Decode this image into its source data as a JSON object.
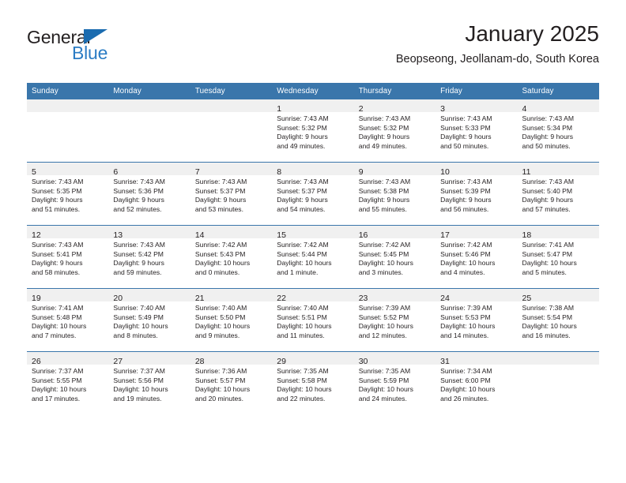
{
  "brand": {
    "name_part1": "General",
    "name_part2": "Blue",
    "triangle_color": "#1b6cb0",
    "blue_color": "#2b7cc4"
  },
  "header": {
    "title": "January 2025",
    "subtitle": "Beopseong, Jeollanam-do, South Korea"
  },
  "theme": {
    "header_bg": "#3a76ab",
    "daynum_bg": "#f0f0f0",
    "text": "#231f20"
  },
  "weekday_headers": [
    "Sunday",
    "Monday",
    "Tuesday",
    "Wednesday",
    "Thursday",
    "Friday",
    "Saturday"
  ],
  "weeks": [
    [
      {
        "day": "",
        "empty": true
      },
      {
        "day": "",
        "empty": true
      },
      {
        "day": "",
        "empty": true
      },
      {
        "day": "1",
        "sunrise": "Sunrise: 7:43 AM",
        "sunset": "Sunset: 5:32 PM",
        "daylight1": "Daylight: 9 hours",
        "daylight2": "and 49 minutes."
      },
      {
        "day": "2",
        "sunrise": "Sunrise: 7:43 AM",
        "sunset": "Sunset: 5:32 PM",
        "daylight1": "Daylight: 9 hours",
        "daylight2": "and 49 minutes."
      },
      {
        "day": "3",
        "sunrise": "Sunrise: 7:43 AM",
        "sunset": "Sunset: 5:33 PM",
        "daylight1": "Daylight: 9 hours",
        "daylight2": "and 50 minutes."
      },
      {
        "day": "4",
        "sunrise": "Sunrise: 7:43 AM",
        "sunset": "Sunset: 5:34 PM",
        "daylight1": "Daylight: 9 hours",
        "daylight2": "and 50 minutes."
      }
    ],
    [
      {
        "day": "5",
        "sunrise": "Sunrise: 7:43 AM",
        "sunset": "Sunset: 5:35 PM",
        "daylight1": "Daylight: 9 hours",
        "daylight2": "and 51 minutes."
      },
      {
        "day": "6",
        "sunrise": "Sunrise: 7:43 AM",
        "sunset": "Sunset: 5:36 PM",
        "daylight1": "Daylight: 9 hours",
        "daylight2": "and 52 minutes."
      },
      {
        "day": "7",
        "sunrise": "Sunrise: 7:43 AM",
        "sunset": "Sunset: 5:37 PM",
        "daylight1": "Daylight: 9 hours",
        "daylight2": "and 53 minutes."
      },
      {
        "day": "8",
        "sunrise": "Sunrise: 7:43 AM",
        "sunset": "Sunset: 5:37 PM",
        "daylight1": "Daylight: 9 hours",
        "daylight2": "and 54 minutes."
      },
      {
        "day": "9",
        "sunrise": "Sunrise: 7:43 AM",
        "sunset": "Sunset: 5:38 PM",
        "daylight1": "Daylight: 9 hours",
        "daylight2": "and 55 minutes."
      },
      {
        "day": "10",
        "sunrise": "Sunrise: 7:43 AM",
        "sunset": "Sunset: 5:39 PM",
        "daylight1": "Daylight: 9 hours",
        "daylight2": "and 56 minutes."
      },
      {
        "day": "11",
        "sunrise": "Sunrise: 7:43 AM",
        "sunset": "Sunset: 5:40 PM",
        "daylight1": "Daylight: 9 hours",
        "daylight2": "and 57 minutes."
      }
    ],
    [
      {
        "day": "12",
        "sunrise": "Sunrise: 7:43 AM",
        "sunset": "Sunset: 5:41 PM",
        "daylight1": "Daylight: 9 hours",
        "daylight2": "and 58 minutes."
      },
      {
        "day": "13",
        "sunrise": "Sunrise: 7:43 AM",
        "sunset": "Sunset: 5:42 PM",
        "daylight1": "Daylight: 9 hours",
        "daylight2": "and 59 minutes."
      },
      {
        "day": "14",
        "sunrise": "Sunrise: 7:42 AM",
        "sunset": "Sunset: 5:43 PM",
        "daylight1": "Daylight: 10 hours",
        "daylight2": "and 0 minutes."
      },
      {
        "day": "15",
        "sunrise": "Sunrise: 7:42 AM",
        "sunset": "Sunset: 5:44 PM",
        "daylight1": "Daylight: 10 hours",
        "daylight2": "and 1 minute."
      },
      {
        "day": "16",
        "sunrise": "Sunrise: 7:42 AM",
        "sunset": "Sunset: 5:45 PM",
        "daylight1": "Daylight: 10 hours",
        "daylight2": "and 3 minutes."
      },
      {
        "day": "17",
        "sunrise": "Sunrise: 7:42 AM",
        "sunset": "Sunset: 5:46 PM",
        "daylight1": "Daylight: 10 hours",
        "daylight2": "and 4 minutes."
      },
      {
        "day": "18",
        "sunrise": "Sunrise: 7:41 AM",
        "sunset": "Sunset: 5:47 PM",
        "daylight1": "Daylight: 10 hours",
        "daylight2": "and 5 minutes."
      }
    ],
    [
      {
        "day": "19",
        "sunrise": "Sunrise: 7:41 AM",
        "sunset": "Sunset: 5:48 PM",
        "daylight1": "Daylight: 10 hours",
        "daylight2": "and 7 minutes."
      },
      {
        "day": "20",
        "sunrise": "Sunrise: 7:40 AM",
        "sunset": "Sunset: 5:49 PM",
        "daylight1": "Daylight: 10 hours",
        "daylight2": "and 8 minutes."
      },
      {
        "day": "21",
        "sunrise": "Sunrise: 7:40 AM",
        "sunset": "Sunset: 5:50 PM",
        "daylight1": "Daylight: 10 hours",
        "daylight2": "and 9 minutes."
      },
      {
        "day": "22",
        "sunrise": "Sunrise: 7:40 AM",
        "sunset": "Sunset: 5:51 PM",
        "daylight1": "Daylight: 10 hours",
        "daylight2": "and 11 minutes."
      },
      {
        "day": "23",
        "sunrise": "Sunrise: 7:39 AM",
        "sunset": "Sunset: 5:52 PM",
        "daylight1": "Daylight: 10 hours",
        "daylight2": "and 12 minutes."
      },
      {
        "day": "24",
        "sunrise": "Sunrise: 7:39 AM",
        "sunset": "Sunset: 5:53 PM",
        "daylight1": "Daylight: 10 hours",
        "daylight2": "and 14 minutes."
      },
      {
        "day": "25",
        "sunrise": "Sunrise: 7:38 AM",
        "sunset": "Sunset: 5:54 PM",
        "daylight1": "Daylight: 10 hours",
        "daylight2": "and 16 minutes."
      }
    ],
    [
      {
        "day": "26",
        "sunrise": "Sunrise: 7:37 AM",
        "sunset": "Sunset: 5:55 PM",
        "daylight1": "Daylight: 10 hours",
        "daylight2": "and 17 minutes."
      },
      {
        "day": "27",
        "sunrise": "Sunrise: 7:37 AM",
        "sunset": "Sunset: 5:56 PM",
        "daylight1": "Daylight: 10 hours",
        "daylight2": "and 19 minutes."
      },
      {
        "day": "28",
        "sunrise": "Sunrise: 7:36 AM",
        "sunset": "Sunset: 5:57 PM",
        "daylight1": "Daylight: 10 hours",
        "daylight2": "and 20 minutes."
      },
      {
        "day": "29",
        "sunrise": "Sunrise: 7:35 AM",
        "sunset": "Sunset: 5:58 PM",
        "daylight1": "Daylight: 10 hours",
        "daylight2": "and 22 minutes."
      },
      {
        "day": "30",
        "sunrise": "Sunrise: 7:35 AM",
        "sunset": "Sunset: 5:59 PM",
        "daylight1": "Daylight: 10 hours",
        "daylight2": "and 24 minutes."
      },
      {
        "day": "31",
        "sunrise": "Sunrise: 7:34 AM",
        "sunset": "Sunset: 6:00 PM",
        "daylight1": "Daylight: 10 hours",
        "daylight2": "and 26 minutes."
      },
      {
        "day": "",
        "empty": true
      }
    ]
  ]
}
